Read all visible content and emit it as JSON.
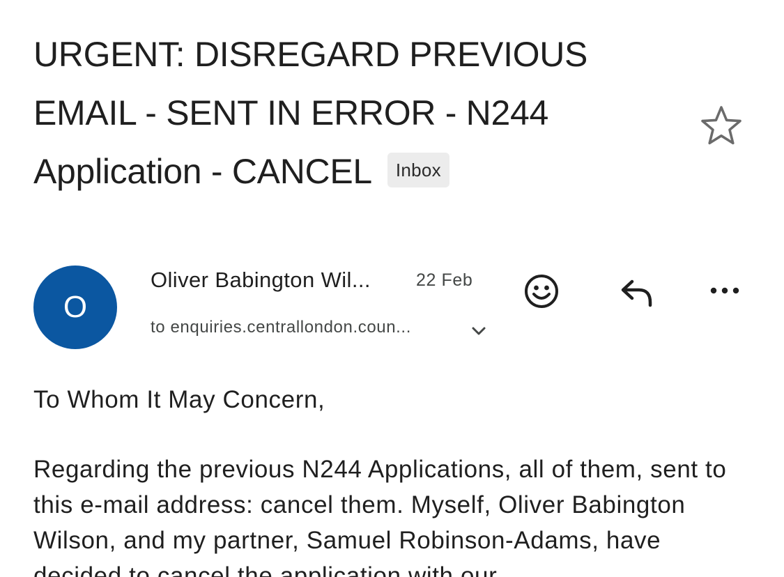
{
  "email": {
    "subject": "URGENT: DISREGARD PREVIOUS EMAIL - SENT IN ERROR - N244 Application - CANCEL",
    "label": "Inbox",
    "sender": {
      "initial": "O",
      "name": "Oliver Babington Wil...",
      "date": "22 Feb",
      "recipient": "to enquiries.centrallondon.coun...",
      "avatar_color": "#0b57a1"
    },
    "body": {
      "greeting": "To Whom It May Concern,",
      "paragraph": "Regarding the previous N244 Applications, all of them, sent to this e-mail address: cancel them. Myself, Oliver Babington Wilson, and my partner, Samuel Robinson-Adams, have decided to cancel the application with our"
    }
  },
  "icons": {
    "star": "star-outline-icon",
    "emoji": "add-reaction-icon",
    "reply": "reply-icon",
    "more": "more-horizontal-icon",
    "expand": "chevron-down-icon"
  }
}
